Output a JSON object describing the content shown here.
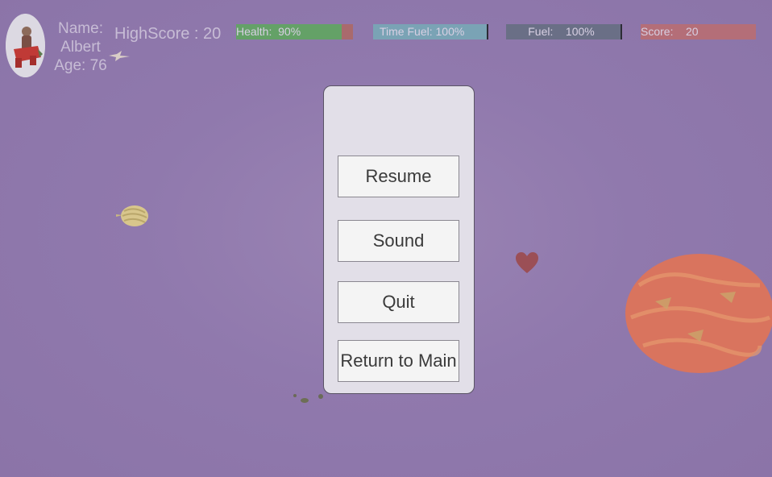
{
  "player": {
    "name_label": "Name:",
    "name": "Albert",
    "age": "Age: 76"
  },
  "highscore": "HighScore : 20",
  "bars": {
    "health": {
      "label": "Health:  90%",
      "value": 0.9
    },
    "time_fuel": {
      "label": "Time Fuel: 100%",
      "value": 1.0
    },
    "fuel": {
      "label": "       Fuel:    100%",
      "value": 1.0
    },
    "score": {
      "label": "Score:    20",
      "value": 1.0
    }
  },
  "pause_menu": {
    "resume": "Resume",
    "sound": "Sound",
    "quit": "Quit",
    "return_main": "Return to Main"
  },
  "colors": {
    "background": "#9079ad",
    "health": "#64a167",
    "time_fuel": "#7aa3b5",
    "fuel": "#6a6f86",
    "score": "#b46e78",
    "planet": "#d9745e"
  }
}
